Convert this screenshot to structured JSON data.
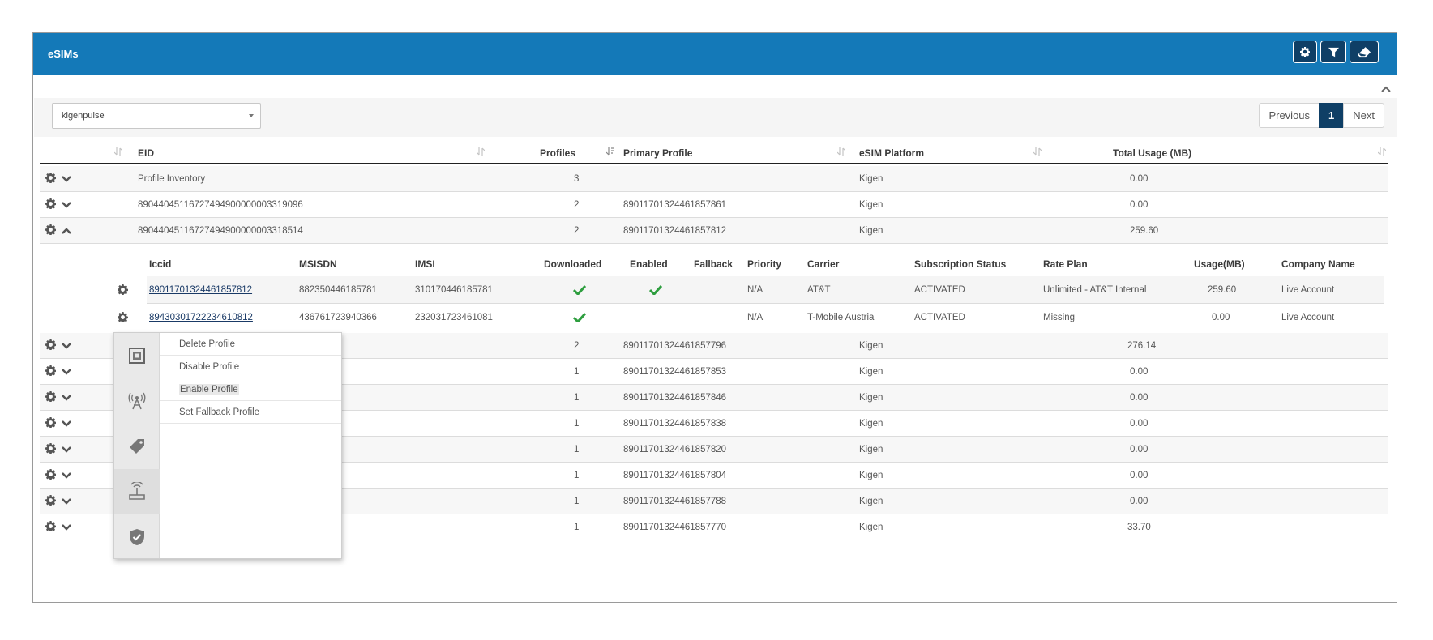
{
  "panel": {
    "title": "eSIMs"
  },
  "header_buttons": [
    {
      "name": "settings-button",
      "icon": "gear-icon"
    },
    {
      "name": "filter-button",
      "icon": "filter-icon"
    },
    {
      "name": "clear-filter-button",
      "icon": "eraser-icon"
    }
  ],
  "filter": {
    "selected": "kigenpulse"
  },
  "pager": {
    "previous": "Previous",
    "page": "1",
    "next": "Next"
  },
  "columns": {
    "eid": "EID",
    "profiles": "Profiles",
    "primary": "Primary Profile",
    "platform": "eSIM Platform",
    "usage": "Total Usage (MB)"
  },
  "rows": [
    {
      "eid": "Profile Inventory",
      "profiles": "3",
      "primary": "",
      "platform": "Kigen",
      "usage": "0.00"
    },
    {
      "eid": "89044045116727494900000003319096",
      "profiles": "2",
      "primary": "8901170132446185786​1",
      "platform": "Kigen",
      "usage": "0.00"
    },
    {
      "eid": "89044045116727494900000003318514",
      "profiles": "2",
      "primary": "89011701324461857812",
      "platform": "Kigen",
      "usage": "259.60"
    },
    {
      "eid": "",
      "profiles": "2",
      "primary": "89011701324461857796",
      "platform": "Kigen",
      "usage": "276.14"
    },
    {
      "eid": "",
      "profiles": "1",
      "primary": "89011701324461857853",
      "platform": "Kigen",
      "usage": "0.00"
    },
    {
      "eid": "",
      "profiles": "1",
      "primary": "89011701324461857846",
      "platform": "Kigen",
      "usage": "0.00"
    },
    {
      "eid": "",
      "profiles": "1",
      "primary": "89011701324461857838",
      "platform": "Kigen",
      "usage": "0.00"
    },
    {
      "eid": "",
      "profiles": "1",
      "primary": "89011701324461857820",
      "platform": "Kigen",
      "usage": "0.00"
    },
    {
      "eid": "",
      "profiles": "1",
      "primary": "89011701324461857804",
      "platform": "Kigen",
      "usage": "0.00"
    },
    {
      "eid": "",
      "profiles": "1",
      "primary": "89011701324461857788",
      "platform": "Kigen",
      "usage": "0.00"
    },
    {
      "eid": "",
      "profiles": "1",
      "primary": "89011701324461857770",
      "platform": "Kigen",
      "usage": "33.70"
    }
  ],
  "sub_columns": {
    "iccid": "Iccid",
    "msisdn": "MSISDN",
    "imsi": "IMSI",
    "downloaded": "Downloaded",
    "enabled": "Enabled",
    "fallback": "Fallback",
    "priority": "Priority",
    "carrier": "Carrier",
    "status": "Subscription Status",
    "rate": "Rate Plan",
    "usage": "Usage(MB)",
    "company": "Company Name"
  },
  "sub_rows": [
    {
      "iccid": "89011701324461857812",
      "msisdn": "882350446185781",
      "imsi": "310170446185781",
      "downloaded": true,
      "enabled": true,
      "priority": "N/A",
      "carrier": "AT&T",
      "status": "ACTIVATED",
      "rate": "Unlimited - AT&T Internal",
      "usage": "259.60",
      "company": "Live Account"
    },
    {
      "iccid": "89430301722234610812",
      "msisdn": "436761723940366",
      "imsi": "232031723461081",
      "downloaded": true,
      "enabled": false,
      "priority": "N/A",
      "carrier": "T-Mobile Austria",
      "status": "ACTIVATED",
      "rate": "Missing",
      "usage": "0.00",
      "company": "Live Account"
    }
  ],
  "context_menu": {
    "rail_icons": [
      "sim-card-icon",
      "antenna-icon",
      "tag-icon",
      "router-icon",
      "shield-icon"
    ],
    "items": [
      "Delete Profile",
      "Disable Profile",
      "Enable Profile",
      "Set Fallback Profile"
    ],
    "highlighted": "Enable Profile"
  },
  "colors": {
    "header": "#1479b8",
    "active_page": "#0f3f66",
    "check": "#2e9e3f"
  }
}
